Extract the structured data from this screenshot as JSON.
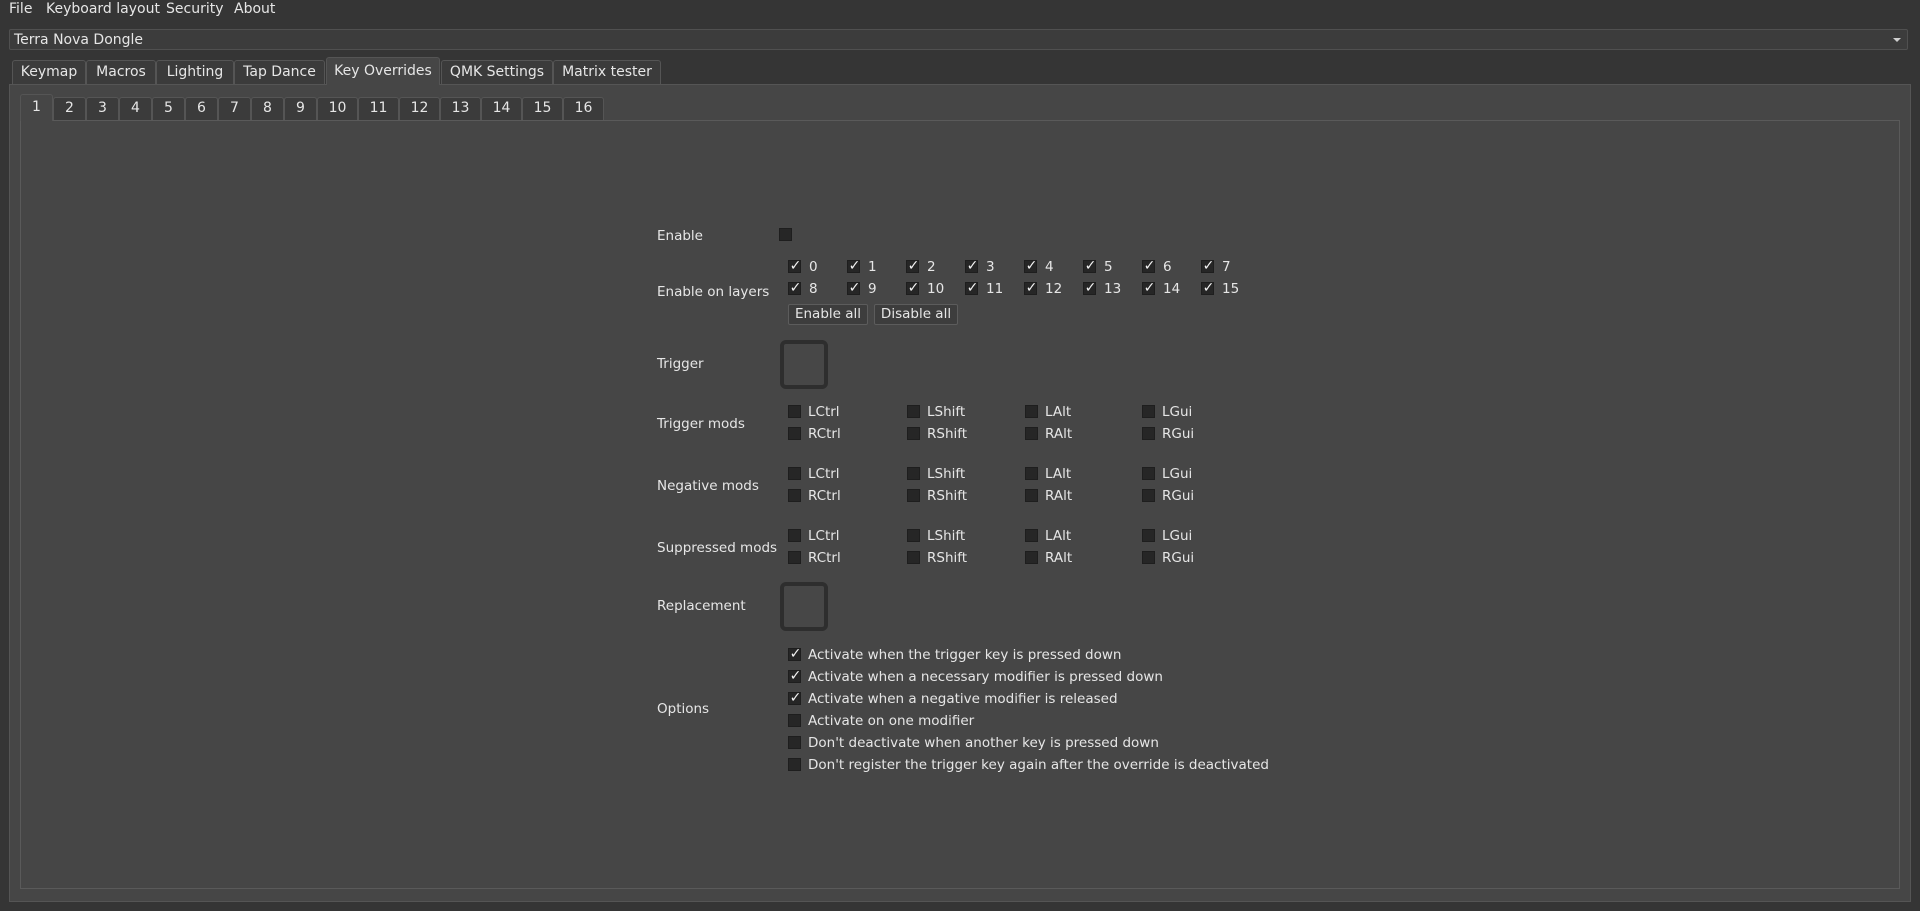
{
  "menu": [
    "File",
    "Keyboard layout",
    "Security",
    "About"
  ],
  "device": {
    "selected": "Terra Nova Dongle"
  },
  "main_tabs": [
    "Keymap",
    "Macros",
    "Lighting",
    "Tap Dance",
    "Key Overrides",
    "QMK Settings",
    "Matrix tester"
  ],
  "active_main_tab": "Key Overrides",
  "override_tabs": [
    "1",
    "2",
    "3",
    "4",
    "5",
    "6",
    "7",
    "8",
    "9",
    "10",
    "11",
    "12",
    "13",
    "14",
    "15",
    "16"
  ],
  "active_override_tab": "1",
  "form": {
    "enable": {
      "label": "Enable",
      "checked": false
    },
    "layers": {
      "label": "Enable on layers",
      "items": [
        {
          "label": "0",
          "checked": true
        },
        {
          "label": "1",
          "checked": true
        },
        {
          "label": "2",
          "checked": true
        },
        {
          "label": "3",
          "checked": true
        },
        {
          "label": "4",
          "checked": true
        },
        {
          "label": "5",
          "checked": true
        },
        {
          "label": "6",
          "checked": true
        },
        {
          "label": "7",
          "checked": true
        },
        {
          "label": "8",
          "checked": true
        },
        {
          "label": "9",
          "checked": true
        },
        {
          "label": "10",
          "checked": true
        },
        {
          "label": "11",
          "checked": true
        },
        {
          "label": "12",
          "checked": true
        },
        {
          "label": "13",
          "checked": true
        },
        {
          "label": "14",
          "checked": true
        },
        {
          "label": "15",
          "checked": true
        }
      ],
      "enable_all": "Enable all",
      "disable_all": "Disable all"
    },
    "trigger": {
      "label": "Trigger"
    },
    "trigger_mods": {
      "label": "Trigger mods",
      "items": [
        {
          "label": "LCtrl",
          "checked": false
        },
        {
          "label": "LShift",
          "checked": false
        },
        {
          "label": "LAlt",
          "checked": false
        },
        {
          "label": "LGui",
          "checked": false
        },
        {
          "label": "RCtrl",
          "checked": false
        },
        {
          "label": "RShift",
          "checked": false
        },
        {
          "label": "RAlt",
          "checked": false
        },
        {
          "label": "RGui",
          "checked": false
        }
      ]
    },
    "negative_mods": {
      "label": "Negative mods",
      "items": [
        {
          "label": "LCtrl",
          "checked": false
        },
        {
          "label": "LShift",
          "checked": false
        },
        {
          "label": "LAlt",
          "checked": false
        },
        {
          "label": "LGui",
          "checked": false
        },
        {
          "label": "RCtrl",
          "checked": false
        },
        {
          "label": "RShift",
          "checked": false
        },
        {
          "label": "RAlt",
          "checked": false
        },
        {
          "label": "RGui",
          "checked": false
        }
      ]
    },
    "suppressed_mods": {
      "label": "Suppressed mods",
      "items": [
        {
          "label": "LCtrl",
          "checked": false
        },
        {
          "label": "LShift",
          "checked": false
        },
        {
          "label": "LAlt",
          "checked": false
        },
        {
          "label": "LGui",
          "checked": false
        },
        {
          "label": "RCtrl",
          "checked": false
        },
        {
          "label": "RShift",
          "checked": false
        },
        {
          "label": "RAlt",
          "checked": false
        },
        {
          "label": "RGui",
          "checked": false
        }
      ]
    },
    "replacement": {
      "label": "Replacement"
    },
    "options": {
      "label": "Options",
      "items": [
        {
          "label": "Activate when the trigger key is pressed down",
          "checked": true
        },
        {
          "label": "Activate when a necessary modifier is pressed down",
          "checked": true
        },
        {
          "label": "Activate when a negative modifier is released",
          "checked": true
        },
        {
          "label": "Activate on one modifier",
          "checked": false
        },
        {
          "label": "Don't deactivate when another key is pressed down",
          "checked": false
        },
        {
          "label": "Don't register the trigger key again after the override is deactivated",
          "checked": false
        }
      ]
    }
  }
}
